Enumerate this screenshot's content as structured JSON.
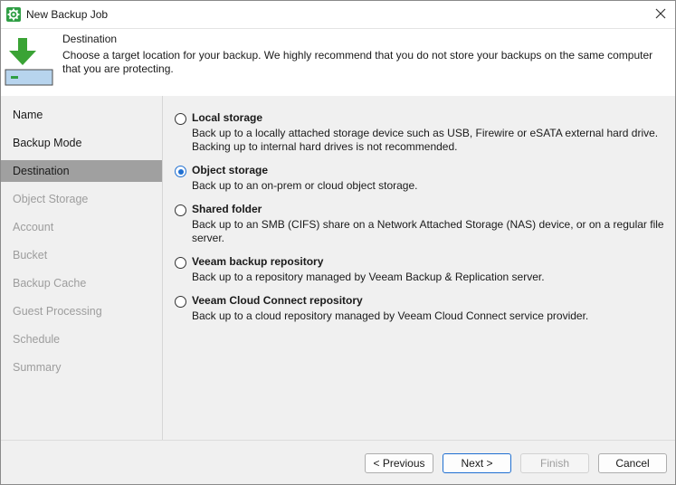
{
  "window": {
    "title": "New Backup Job"
  },
  "header": {
    "title": "Destination",
    "description": "Choose a target location for your backup. We highly recommend that you do not store your backups on the same computer that you are protecting."
  },
  "steps": [
    {
      "label": "Name",
      "state": "enabled"
    },
    {
      "label": "Backup Mode",
      "state": "enabled"
    },
    {
      "label": "Destination",
      "state": "active"
    },
    {
      "label": "Object Storage",
      "state": "disabled"
    },
    {
      "label": "Account",
      "state": "disabled"
    },
    {
      "label": "Bucket",
      "state": "disabled"
    },
    {
      "label": "Backup Cache",
      "state": "disabled"
    },
    {
      "label": "Guest Processing",
      "state": "disabled"
    },
    {
      "label": "Schedule",
      "state": "disabled"
    },
    {
      "label": "Summary",
      "state": "disabled"
    }
  ],
  "options": [
    {
      "title": "Local storage",
      "description": "Back up to a locally attached storage device such as USB, Firewire or eSATA external hard drive. Backing up to internal hard drives is not recommended.",
      "selected": false
    },
    {
      "title": "Object storage",
      "description": "Back up to an on-prem or cloud object storage.",
      "selected": true
    },
    {
      "title": "Shared folder",
      "description": "Back up to an SMB (CIFS) share on a Network Attached Storage (NAS) device, or on a regular file server.",
      "selected": false
    },
    {
      "title": "Veeam backup repository",
      "description": "Back up to a repository managed by Veeam Backup & Replication server.",
      "selected": false
    },
    {
      "title": "Veeam Cloud Connect repository",
      "description": "Back up to a cloud repository managed by Veeam Cloud Connect service provider.",
      "selected": false
    }
  ],
  "buttons": {
    "previous": "< Previous",
    "next": "Next >",
    "finish": "Finish",
    "cancel": "Cancel"
  },
  "colors": {
    "accent": "#1f6fd1",
    "active_step": "#a0a0a0",
    "disabled_text": "#9d9d9d",
    "icon_green": "#2f9e44"
  }
}
